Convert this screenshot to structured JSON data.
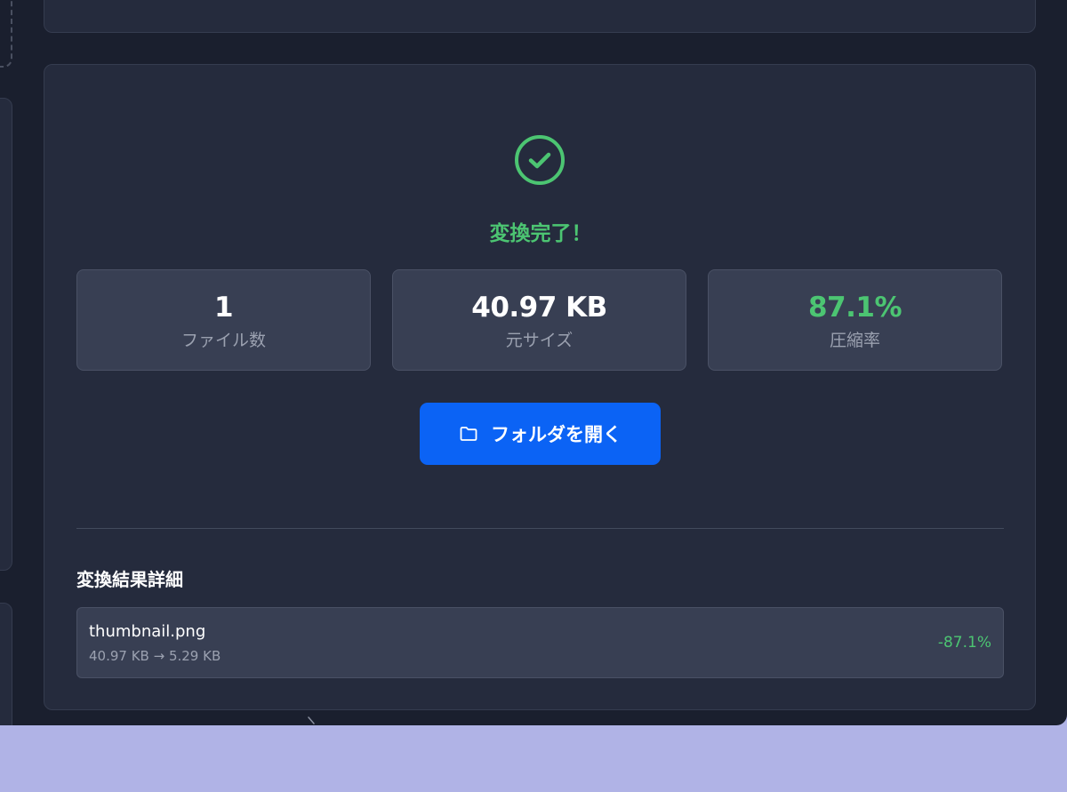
{
  "result": {
    "title": "変換完了！",
    "status_icon": "check-circle-icon",
    "accent_color": "#4cc572",
    "stats": [
      {
        "value": "1",
        "label": "ファイル数"
      },
      {
        "value": "40.97 KB",
        "label": "元サイズ"
      },
      {
        "value": "87.1%",
        "label": "圧縮率"
      }
    ],
    "open_folder": {
      "label": "フォルダを開く",
      "icon": "folder-icon",
      "color": "#0b63f5"
    },
    "details": {
      "heading": "変換結果詳細",
      "files": [
        {
          "name": "thumbnail.png",
          "sizes": "40.97 KB → 5.29 KB",
          "reduction": "-87.1%"
        }
      ]
    }
  }
}
